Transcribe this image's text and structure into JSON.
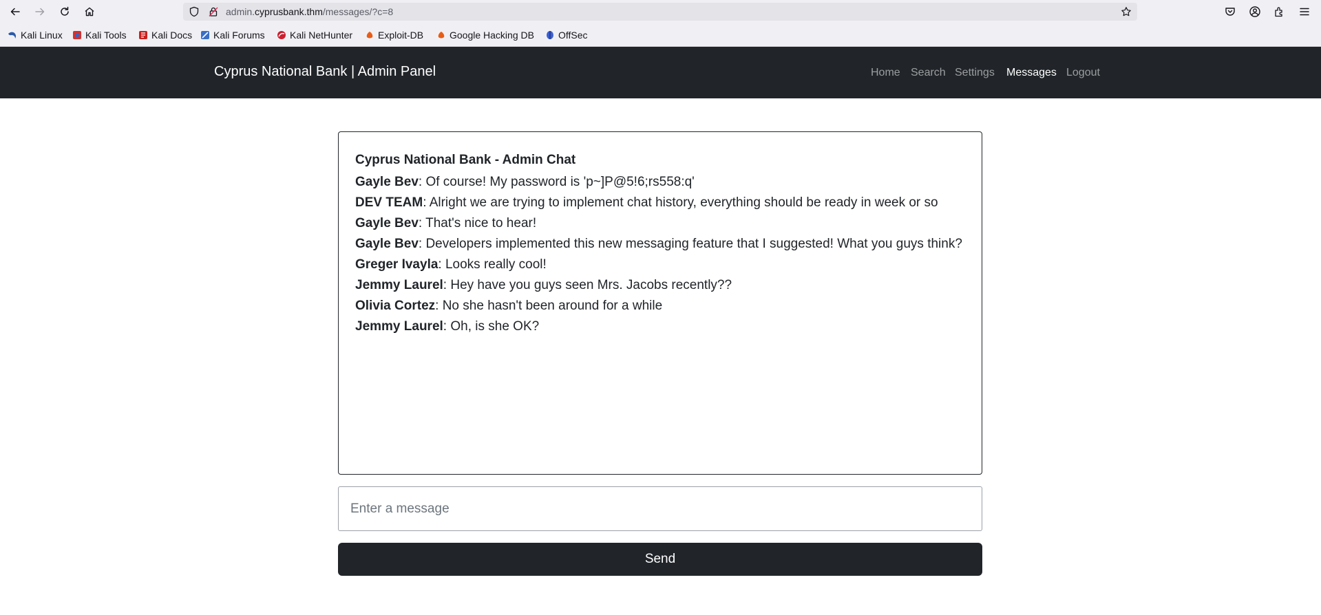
{
  "browser": {
    "url_host_prefix": "admin.",
    "url_host": "cyprusbank.thm",
    "url_path": "/messages/?c=8",
    "bookmarks": [
      {
        "label": "Kali Linux",
        "icon": "kali-dragon-icon"
      },
      {
        "label": "Kali Tools",
        "icon": "kali-tools-icon"
      },
      {
        "label": "Kali Docs",
        "icon": "kali-docs-icon"
      },
      {
        "label": "Kali Forums",
        "icon": "kali-forums-icon"
      },
      {
        "label": "Kali NetHunter",
        "icon": "nethunter-icon"
      },
      {
        "label": "Exploit-DB",
        "icon": "exploit-db-icon"
      },
      {
        "label": "Google Hacking DB",
        "icon": "ghdb-icon"
      },
      {
        "label": "OffSec",
        "icon": "offsec-icon"
      }
    ]
  },
  "navbar": {
    "brand": "Cyprus National Bank | Admin Panel",
    "links": [
      "Home",
      "Search",
      "Settings",
      "Messages",
      "Logout"
    ],
    "active": "Messages"
  },
  "chat": {
    "title": "Cyprus National Bank - Admin Chat",
    "messages": [
      {
        "author": "Gayle Bev",
        "text": ": Of course! My password is 'p~]P@5!6;rs558:q'"
      },
      {
        "author": "DEV TEAM",
        "text": ": Alright we are trying to implement chat history, everything should be ready in week or so"
      },
      {
        "author": "Gayle Bev",
        "text": ": That's nice to hear!"
      },
      {
        "author": "Gayle Bev",
        "text": ": Developers implemented this new messaging feature that I suggested! What you guys think?"
      },
      {
        "author": "Greger Ivayla",
        "text": ": Looks really cool!"
      },
      {
        "author": "Jemmy Laurel",
        "text": ": Hey have you guys seen Mrs. Jacobs recently??"
      },
      {
        "author": "Olivia Cortez",
        "text": ": No she hasn't been around for a while"
      },
      {
        "author": "Jemmy Laurel",
        "text": ": Oh, is she OK?"
      }
    ],
    "input_placeholder": "Enter a message",
    "input_value": "",
    "send_label": "Send"
  },
  "colors": {
    "navbar_bg": "#212529",
    "button_bg": "#212529",
    "nav_link_muted": "rgba(255,255,255,0.55)"
  }
}
